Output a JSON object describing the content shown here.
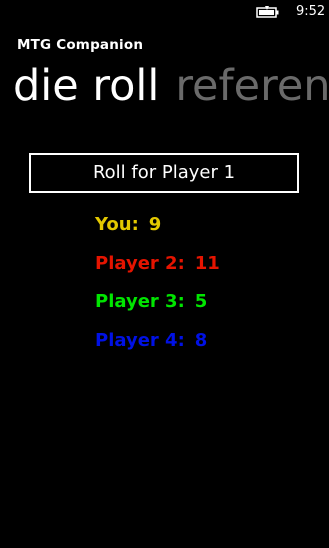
{
  "status_bar": {
    "time": "9:52",
    "battery_icon": "battery-charging-icon"
  },
  "app": {
    "title": "MTG Companion"
  },
  "pivot": {
    "items": [
      {
        "label": "die roll",
        "active": true
      },
      {
        "label": "reference",
        "active": false
      }
    ]
  },
  "roll_button": {
    "label": "Roll for Player 1"
  },
  "results": [
    {
      "label": "You:",
      "value": "9",
      "color": "#e3c800"
    },
    {
      "label": "Player 2:",
      "value": "11",
      "color": "#e51400"
    },
    {
      "label": "Player 3:",
      "value": "5",
      "color": "#00e500"
    },
    {
      "label": "Player 4:",
      "value": "8",
      "color": "#0011e5"
    }
  ]
}
